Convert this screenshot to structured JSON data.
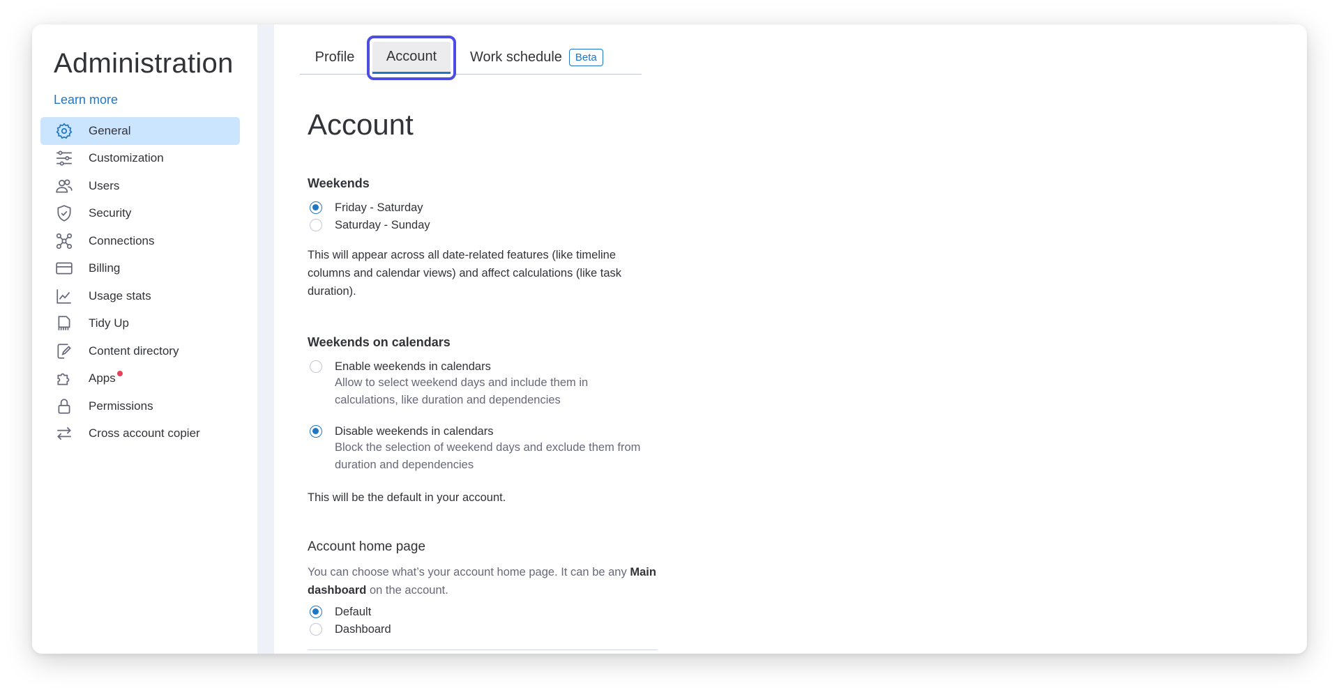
{
  "sidebar": {
    "title": "Administration",
    "learn_more": "Learn more",
    "items": [
      {
        "label": "General",
        "icon": "gear-icon",
        "active": true
      },
      {
        "label": "Customization",
        "icon": "sliders-icon"
      },
      {
        "label": "Users",
        "icon": "users-icon"
      },
      {
        "label": "Security",
        "icon": "shield-icon"
      },
      {
        "label": "Connections",
        "icon": "connections-icon"
      },
      {
        "label": "Billing",
        "icon": "credit-card-icon"
      },
      {
        "label": "Usage stats",
        "icon": "chart-icon"
      },
      {
        "label": "Tidy Up",
        "icon": "broom-icon"
      },
      {
        "label": "Content directory",
        "icon": "document-edit-icon"
      },
      {
        "label": "Apps",
        "icon": "puzzle-icon",
        "notification_dot": true
      },
      {
        "label": "Permissions",
        "icon": "lock-icon"
      },
      {
        "label": "Cross account copier",
        "icon": "arrows-swap-icon"
      }
    ]
  },
  "tabs": {
    "profile": "Profile",
    "account": "Account",
    "work_schedule": "Work schedule",
    "beta_badge": "Beta"
  },
  "main": {
    "title": "Account",
    "weekends": {
      "heading": "Weekends",
      "options": [
        "Friday - Saturday",
        "Saturday - Sunday"
      ],
      "selected": "Friday - Saturday",
      "description": "This will appear across all date-related features (like timeline columns and calendar views) and affect calculations (like task duration)."
    },
    "weekends_on_calendars": {
      "heading": "Weekends on calendars",
      "enable_label": "Enable weekends in calendars",
      "enable_desc": "Allow to select weekend days and include them in calculations, like duration and dependencies",
      "disable_label": "Disable weekends in calendars",
      "disable_desc": "Block the selection of weekend days and exclude them from duration and dependencies",
      "selected": "Disable weekends in calendars",
      "footer": "This will be the default in your account."
    },
    "home_page": {
      "heading": "Account home page",
      "desc_prefix": "You can choose what’s your account home page. It can be any",
      "desc_bold": "Main dashboard",
      "desc_suffix": "on the account.",
      "options": [
        "Default",
        "Dashboard"
      ],
      "selected": "Default"
    }
  },
  "colors": {
    "accent": "#1f76c2",
    "active_nav_bg": "#cce5ff",
    "highlight_border": "#4b4ee0",
    "notification_dot": "#e2445c"
  }
}
